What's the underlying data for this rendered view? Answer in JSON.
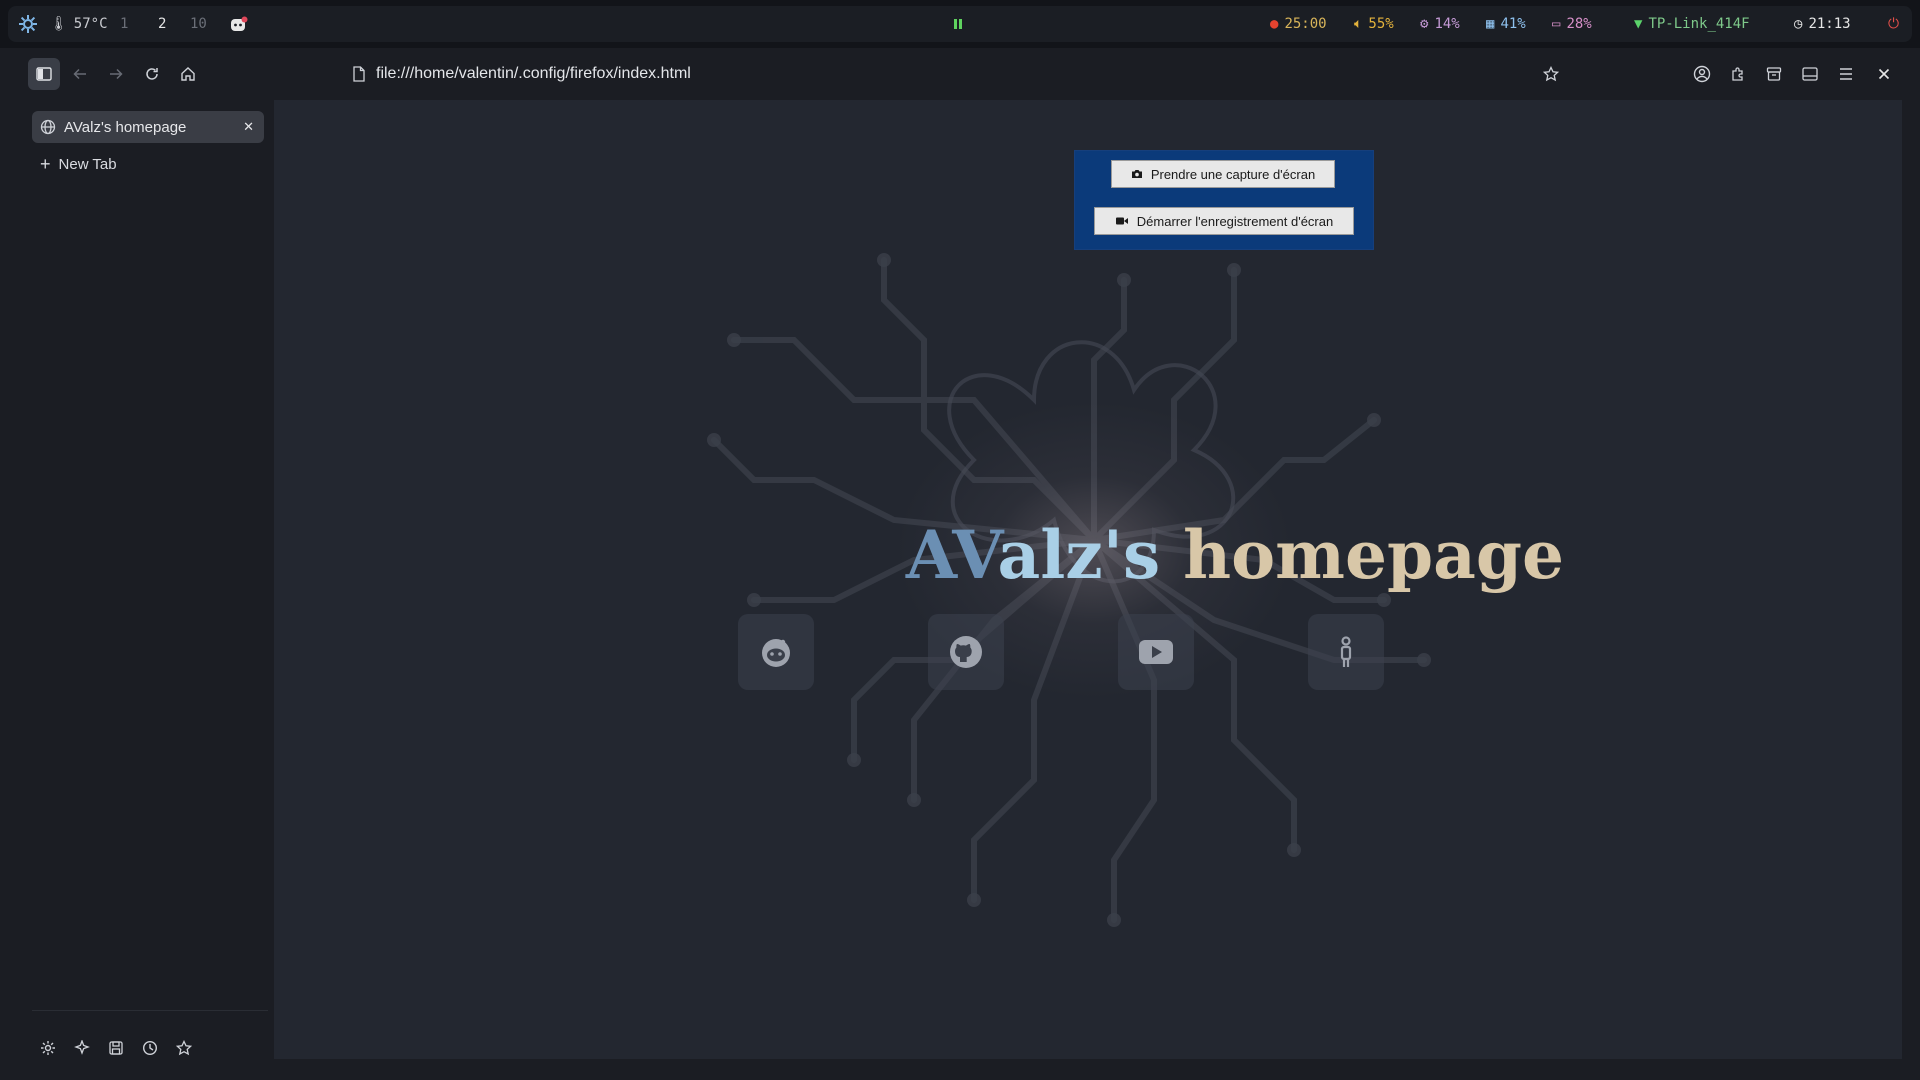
{
  "topbar": {
    "cpu_temp": "57°C",
    "workspaces": [
      "1",
      "2",
      "10"
    ],
    "active_workspace": "2",
    "pomodoro": "25:00",
    "volume": "55%",
    "cpu": "14%",
    "memory": "41%",
    "battery": "28%",
    "wifi": "TP-Link_414F",
    "time": "21:13"
  },
  "browser": {
    "url": "file:///home/valentin/.config/firefox/index.html",
    "tabs": [
      {
        "label": "AValz's homepage"
      }
    ],
    "new_tab_label": "New Tab"
  },
  "page": {
    "title_part1": "AV",
    "title_part2": "alz's",
    "title_part3": "homepage",
    "links": [
      "reddit-icon",
      "github-icon",
      "youtube-icon",
      "person-icon"
    ]
  },
  "screenshot_popup": {
    "capture_label": "Prendre une capture d'écran",
    "record_label": "Démarrer l'enregistrement d'écran"
  },
  "colors": {
    "title_dark_blue": "#6b8fb3",
    "title_light_blue": "#a9cfe6",
    "title_beige": "#d8c7a8",
    "popup_bg": "#0b3a7a"
  }
}
